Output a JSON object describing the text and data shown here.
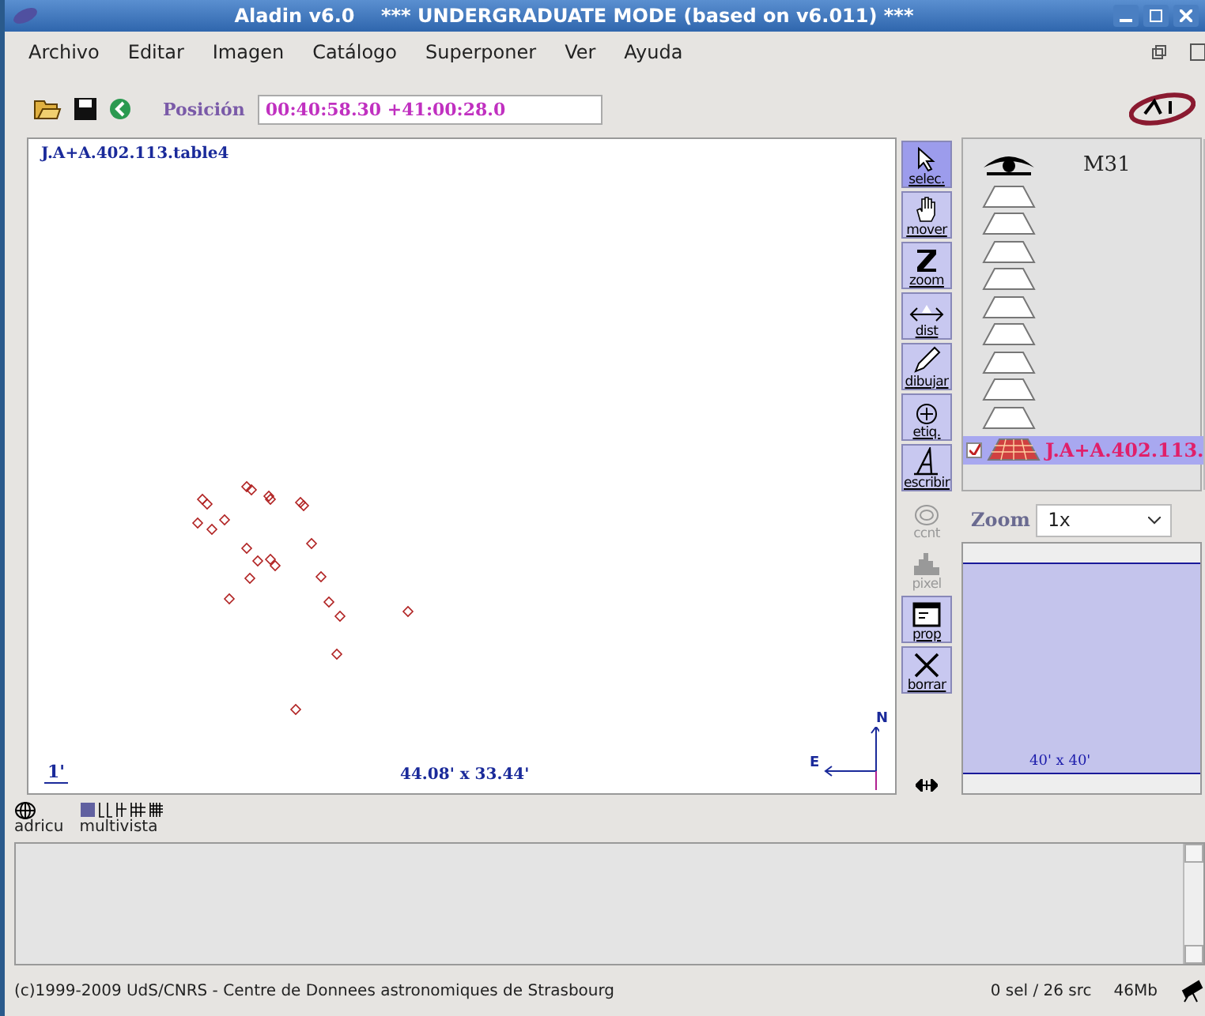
{
  "window": {
    "title": "Aladin v6.0    *** UNDERGRADUATE MODE (based on v6.011) ***"
  },
  "menu": [
    "Archivo",
    "Editar",
    "Imagen",
    "Catálogo",
    "Superponer",
    "Ver",
    "Ayuda"
  ],
  "toolbar": {
    "position_label": "Posición",
    "position_value": "00:40:58.30 +41:00:28.0"
  },
  "view": {
    "plane_label": "J.A+A.402.113.table4",
    "scale": "1'",
    "field_size": "44.08' x 33.44'",
    "north": "N",
    "east": "E"
  },
  "tools": [
    {
      "kind": "select",
      "label": "selec.",
      "selected": true,
      "disabled": false
    },
    {
      "kind": "pan",
      "label": "mover",
      "selected": false,
      "disabled": false
    },
    {
      "kind": "zoom",
      "label": "zoom",
      "selected": false,
      "disabled": false
    },
    {
      "kind": "dist",
      "label": "dist",
      "selected": false,
      "disabled": false
    },
    {
      "kind": "draw",
      "label": "dibujar",
      "selected": false,
      "disabled": false
    },
    {
      "kind": "tag",
      "label": "etiq.",
      "selected": false,
      "disabled": false
    },
    {
      "kind": "write",
      "label": "escribir",
      "selected": false,
      "disabled": false
    },
    {
      "kind": "contour",
      "label": "ccnt",
      "selected": false,
      "disabled": true
    },
    {
      "kind": "pixel",
      "label": "pixel",
      "selected": false,
      "disabled": true
    },
    {
      "kind": "prop",
      "label": "prop",
      "selected": false,
      "disabled": false
    },
    {
      "kind": "delete",
      "label": "borrar",
      "selected": false,
      "disabled": false
    }
  ],
  "layers": {
    "target": "M31",
    "planes": [
      {
        "kind": "empty"
      },
      {
        "kind": "empty"
      },
      {
        "kind": "empty"
      },
      {
        "kind": "empty"
      },
      {
        "kind": "empty"
      },
      {
        "kind": "empty"
      },
      {
        "kind": "empty"
      },
      {
        "kind": "empty"
      },
      {
        "kind": "empty"
      },
      {
        "kind": "catalog",
        "label": "J.A+A.402.113.",
        "checked": true,
        "selected": true
      }
    ]
  },
  "zoom": {
    "label": "Zoom",
    "value": "1x"
  },
  "panner": {
    "field": "40' x 40'"
  },
  "view_modes": {
    "globe_label": "adricu",
    "multiview_label": "multivista"
  },
  "status_bar": {
    "copyright": "(c)1999-2009 UdS/CNRS - Centre de Donnees astronomiques de Strasbourg",
    "selection": "0 sel / 26 src",
    "memory": "46Mb"
  }
}
